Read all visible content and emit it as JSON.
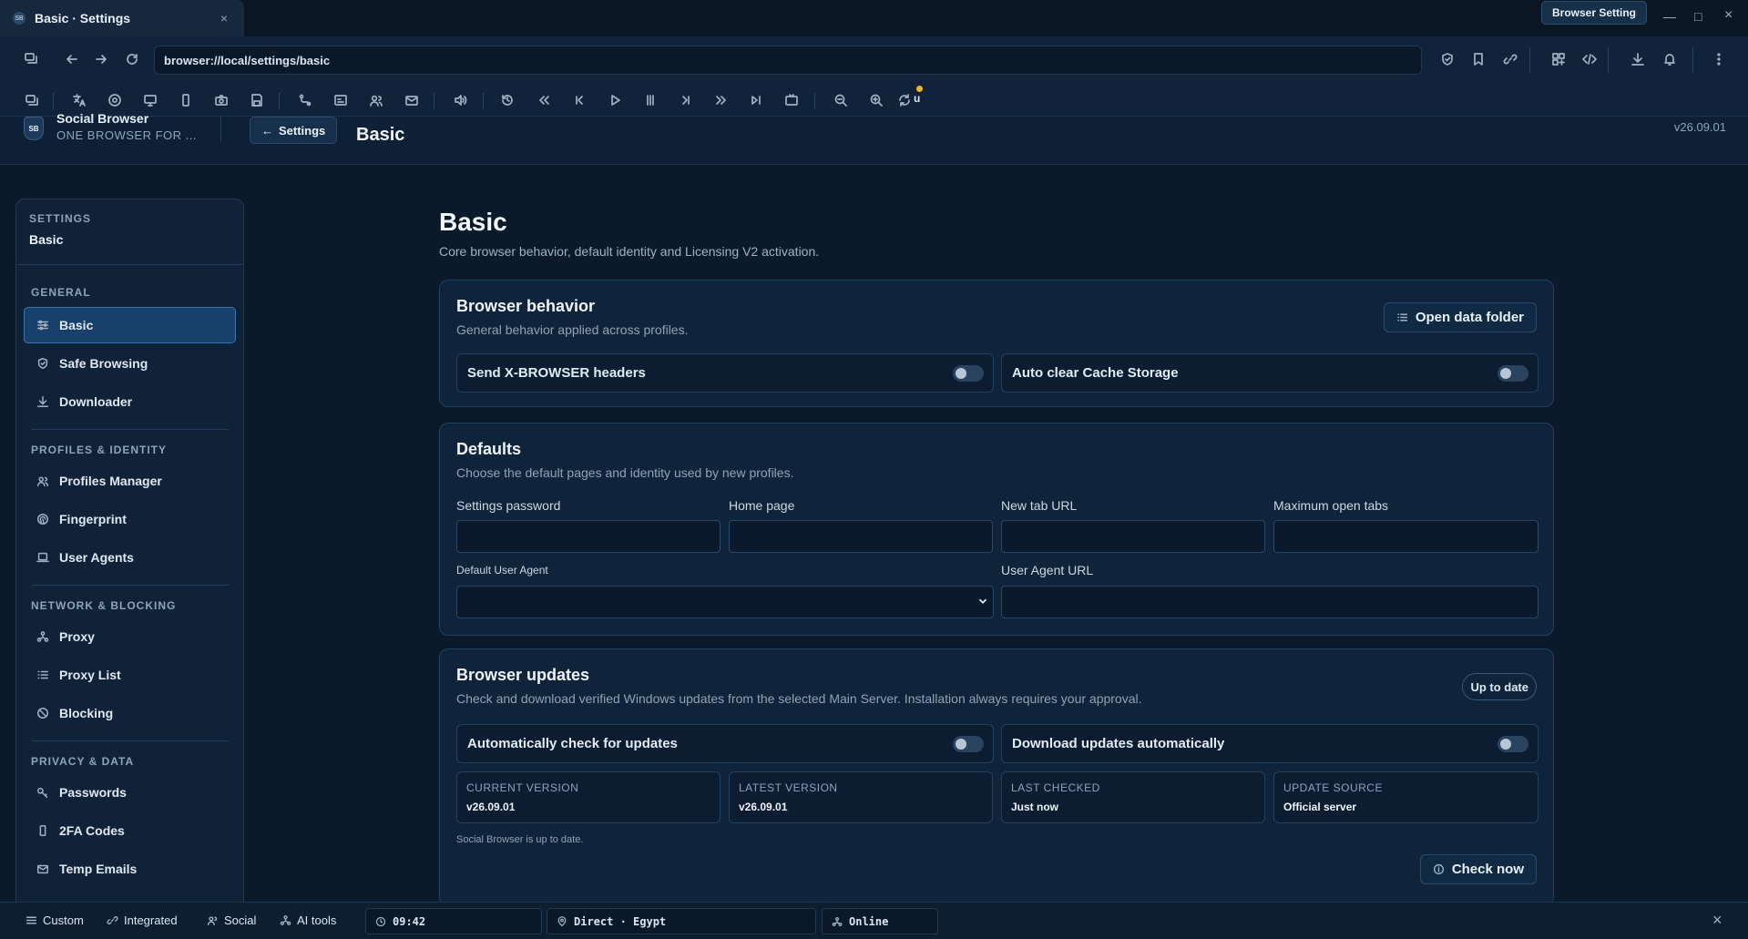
{
  "window": {
    "tab_title": "Basic · Settings",
    "tab_close": "×",
    "badge": "Browser Setting",
    "minimize": "—",
    "maximize": "□",
    "close": "×"
  },
  "address": {
    "url": "browser://local/settings/basic"
  },
  "app": {
    "logo_text": "SB",
    "name": "Social Browser",
    "tagline": "ONE BROWSER FOR ...",
    "back_label": "Settings",
    "header_title": "Basic",
    "version": "v26.09.01"
  },
  "sidebar": {
    "overline": "SETTINGS",
    "current": "Basic",
    "groups": [
      {
        "title": "GENERAL",
        "items": [
          {
            "label": "Basic",
            "icon": "sliders-icon"
          },
          {
            "label": "Safe Browsing",
            "icon": "shield-icon"
          },
          {
            "label": "Downloader",
            "icon": "download-icon"
          }
        ]
      },
      {
        "title": "PROFILES & IDENTITY",
        "items": [
          {
            "label": "Profiles Manager",
            "icon": "users-icon"
          },
          {
            "label": "Fingerprint",
            "icon": "fingerprint-icon"
          },
          {
            "label": "User Agents",
            "icon": "laptop-icon"
          }
        ]
      },
      {
        "title": "NETWORK & BLOCKING",
        "items": [
          {
            "label": "Proxy",
            "icon": "network-icon"
          },
          {
            "label": "Proxy List",
            "icon": "list-icon"
          },
          {
            "label": "Blocking",
            "icon": "block-icon"
          }
        ]
      },
      {
        "title": "PRIVACY & DATA",
        "items": [
          {
            "label": "Passwords",
            "icon": "key-icon"
          },
          {
            "label": "2FA Codes",
            "icon": "phone-icon"
          },
          {
            "label": "Temp Emails",
            "icon": "mail-icon"
          }
        ]
      }
    ]
  },
  "page": {
    "title": "Basic",
    "description": "Core browser behavior, default identity and Licensing V2 activation."
  },
  "behavior": {
    "title": "Browser behavior",
    "description": "General behavior applied across profiles.",
    "open_folder": "Open data folder",
    "toggle1": "Send X-BROWSER headers",
    "toggle2": "Auto clear Cache Storage"
  },
  "defaults": {
    "title": "Defaults",
    "description": "Choose the default pages and identity used by new profiles.",
    "settings_password": "Settings password",
    "home_page": "Home page",
    "new_tab_url": "New tab URL",
    "max_tabs": "Maximum open tabs",
    "default_ua": "Default User Agent",
    "ua_url": "User Agent URL"
  },
  "updates": {
    "title": "Browser updates",
    "description": "Check and download verified Windows updates from the selected Main Server. Installation always requires your approval.",
    "status_pill": "Up to date",
    "toggle1": "Automatically check for updates",
    "toggle2": "Download updates automatically",
    "stats": [
      {
        "label": "CURRENT VERSION",
        "value": "v26.09.01"
      },
      {
        "label": "LATEST VERSION",
        "value": "v26.09.01"
      },
      {
        "label": "LAST CHECKED",
        "value": "Just now"
      },
      {
        "label": "UPDATE SOURCE",
        "value": "Official server"
      }
    ],
    "note": "Social Browser is up to date.",
    "check_now": "Check now"
  },
  "statusbar": {
    "custom": "Custom",
    "integrated": "Integrated",
    "social": "Social",
    "ai_tools": "AI tools",
    "time": "09:42",
    "location": "Direct · Egypt",
    "connection": "Online",
    "close": "×"
  },
  "colors": {
    "accent": "#3b74ab",
    "background": "#0a1a2b",
    "card": "#0f233a",
    "badge_dot": "#f0b429"
  }
}
